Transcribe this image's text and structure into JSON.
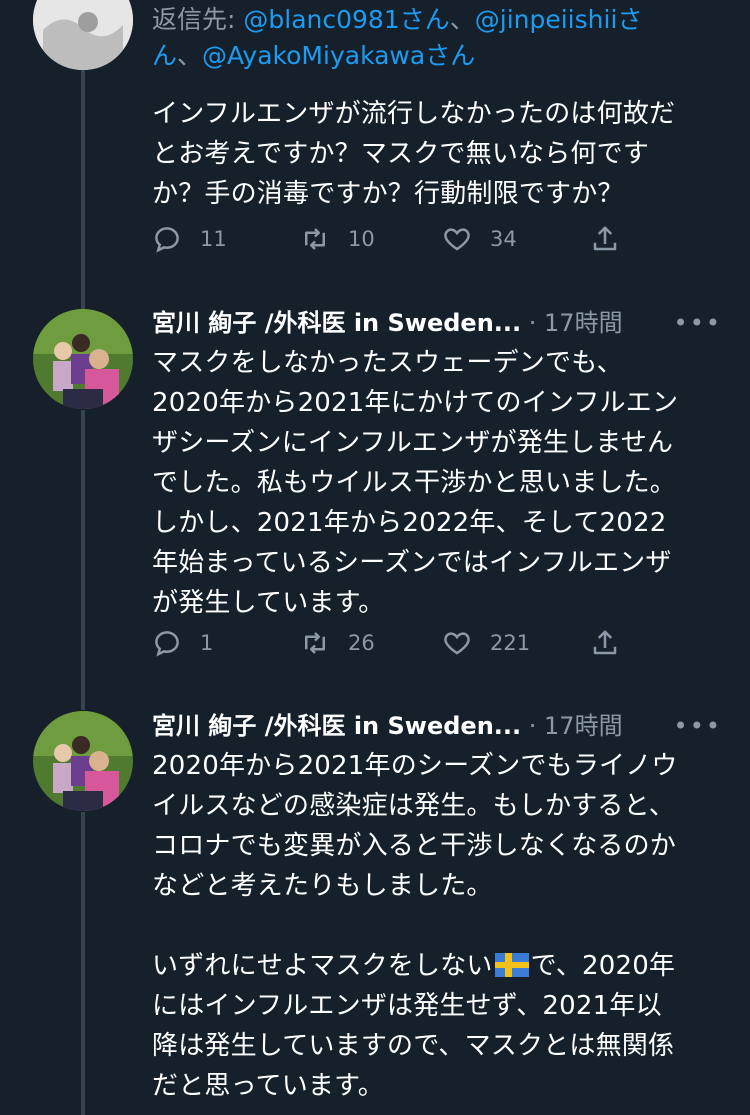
{
  "reply": {
    "prefix": "返信先: ",
    "mentions": [
      "@blanc0981さん",
      "@jinpeiishiiさ",
      "ん",
      "@AyakoMiyakawaさん"
    ],
    "separator": "、"
  },
  "tweets": [
    {
      "text": "インフルエンザが流行しなかったのは何故だ\nとお考えですか？マスクで無いなら何です\nか？手の消毒ですか？行動制限ですか？",
      "replies": "11",
      "retweets": "10",
      "likes": "34"
    },
    {
      "name": "宮川 絢子 /外科医 in Sweden...",
      "time": "· 17時間",
      "more": "•••",
      "text": "マスクをしなかったスウェーデンでも、\n2020年から2021年にかけてのインフルエン\nザシーズンにインフルエンザが発生しません\nでした。私もウイルス干渉かと思いました。\nしかし、2021年から2022年、そして2022\n年始まっているシーズンではインフルエンザ\nが発生しています。",
      "replies": "1",
      "retweets": "26",
      "likes": "221"
    },
    {
      "name": "宮川 絢子 /外科医 in Sweden...",
      "time": "· 17時間",
      "more": "•••",
      "text_a": "2020年から2021年のシーズンでもライノウ\nイルスなどの感染症は発生。もしかすると、\nコロナでも変異が入ると干渉しなくなるのか\nなどと考えたりもしました。\n\nいずれにせよマスクをしない",
      "text_b": "で、2020年\nにはインフルエンザは発生せず、2021年以\n降は発生していますので、マスクとは無関係\nだと思っています。"
    }
  ],
  "icons": {
    "reply": "reply-icon",
    "retweet": "retweet-icon",
    "like": "heart-icon",
    "share": "share-icon",
    "flag": "sweden-flag-icon"
  },
  "colors": {
    "background": "#15202b",
    "secondary_text": "#8b98a5",
    "link": "#1d9bf0",
    "thread_line": "#38444d"
  }
}
